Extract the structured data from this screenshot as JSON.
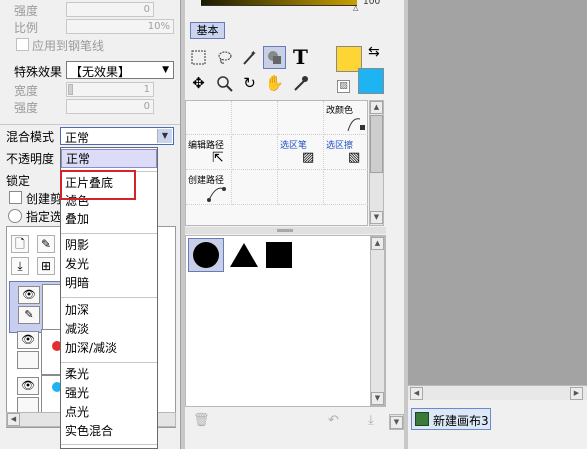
{
  "left": {
    "top_rows": [
      {
        "label": "强度",
        "value": "0"
      },
      {
        "label": "比例",
        "value": "10%"
      }
    ],
    "apply_to_pen": "应用到钢笔线",
    "special_effect": {
      "label": "特殊效果",
      "value": "【无效果】"
    },
    "width": {
      "label": "宽度",
      "value": "1"
    },
    "strength": {
      "label": "强度",
      "value": "0"
    },
    "blend_mode": {
      "label": "混合模式",
      "value": "正常"
    },
    "opacity_label": "不透明度",
    "lock_label": "锁定",
    "create_clip": "创建剪",
    "designated": "指定选"
  },
  "blend_dropdown": {
    "items": [
      "正常",
      "正片叠底",
      "滤色",
      "叠加",
      "阴影",
      "发光",
      "明暗",
      "加深",
      "减淡",
      "加深/减淡",
      "柔光",
      "强光",
      "点光",
      "实色混合"
    ],
    "highlighted": "正片叠底"
  },
  "tools": {
    "tab_basic": "基本",
    "ruler_max": "100",
    "icons": [
      "rect-select-icon",
      "lasso-icon",
      "magic-wand-icon",
      "shape-icon",
      "text-icon",
      "move-icon",
      "zoom-icon",
      "rotate-icon",
      "hand-icon",
      "eyedropper-icon"
    ],
    "fg_color": "#fdd535",
    "bg_color": "#1eb4f4"
  },
  "brushes": {
    "recolor": "改颜色",
    "edit_path": "编辑路径",
    "select_pen": "选区笔",
    "select_eraser": "选区擦",
    "create_path": "创建路径"
  },
  "canvas": {
    "tab_label": "新建画布3"
  }
}
